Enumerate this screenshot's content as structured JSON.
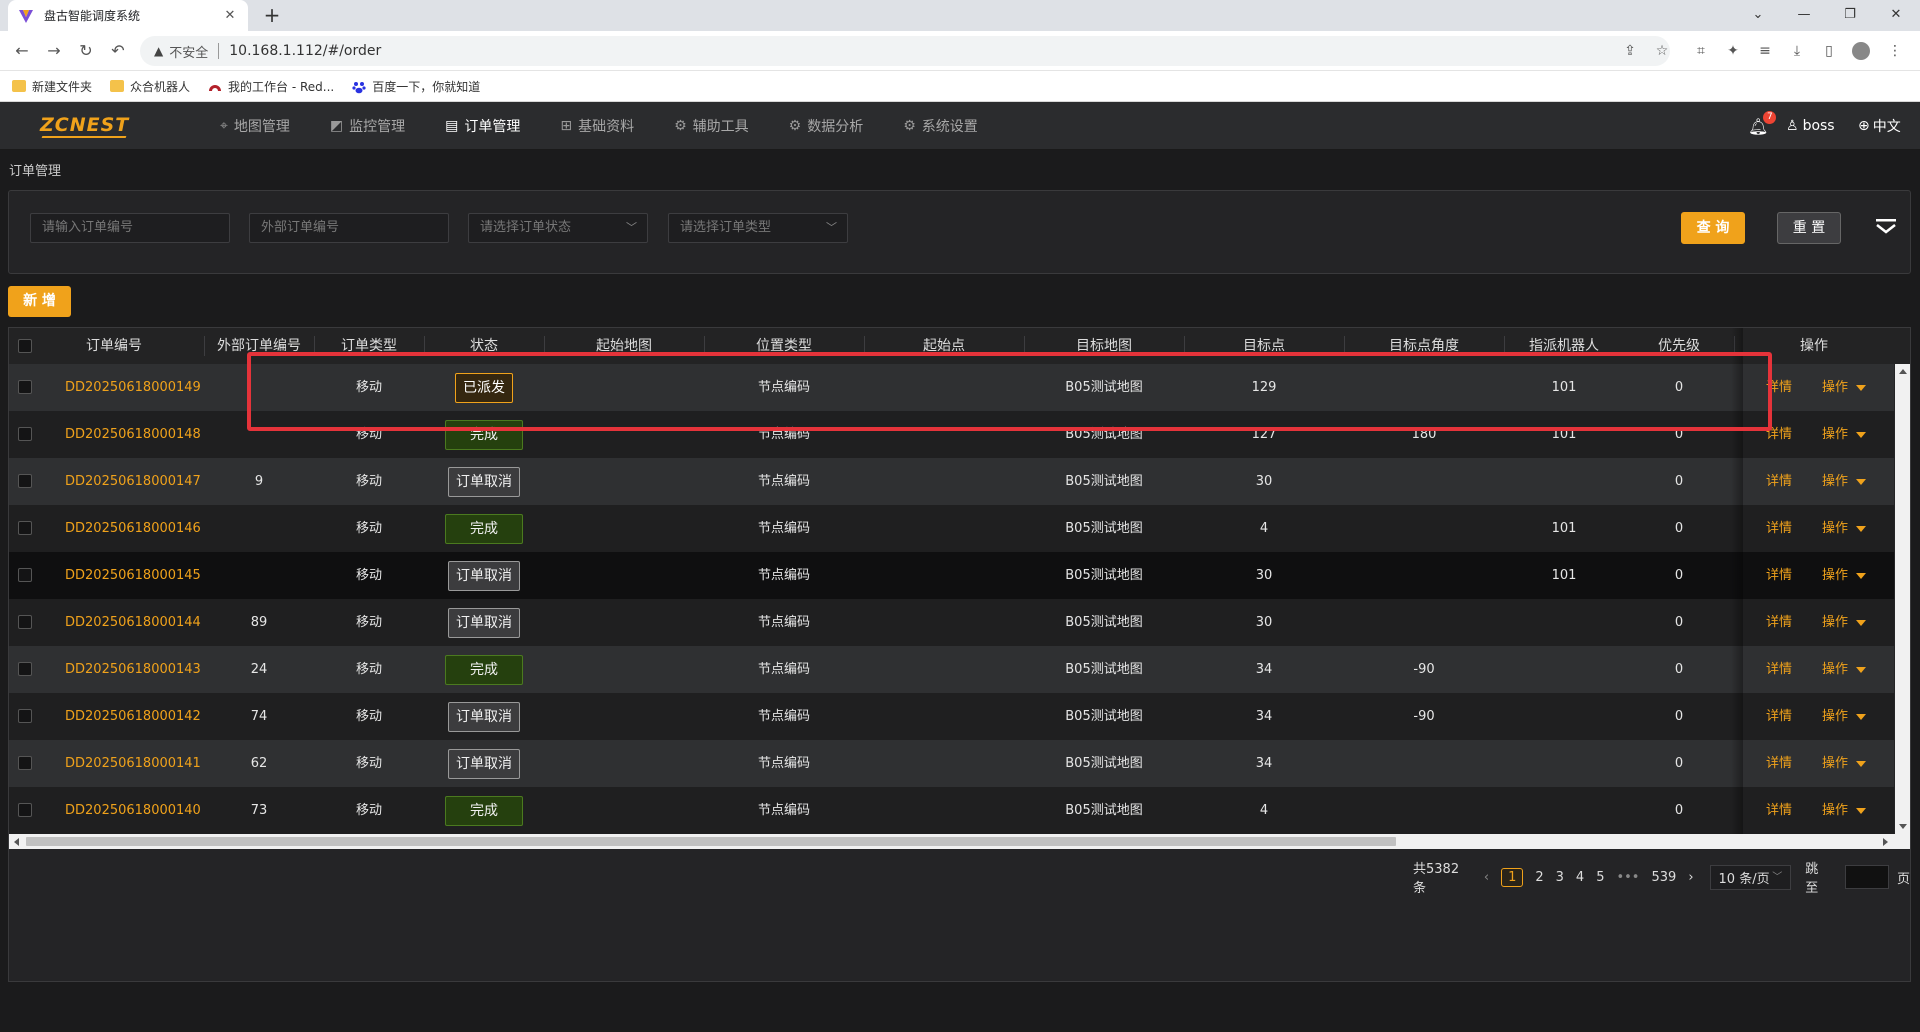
{
  "browser": {
    "tab_title": "盘古智能调度系统",
    "tab_close": "✕",
    "new_tab": "+",
    "insecure_label": "不安全",
    "url": "10.168.1.112/#/order",
    "bookmarks": [
      {
        "label": "新建文件夹",
        "icon": "folder-icon"
      },
      {
        "label": "众合机器人",
        "icon": "folder-icon"
      },
      {
        "label": "我的工作台 - Red...",
        "icon": "redmine-icon"
      },
      {
        "label": "百度一下，你就知道",
        "icon": "baidu-icon"
      }
    ]
  },
  "app": {
    "logo": "ZCNEST",
    "nav": [
      {
        "label": "地图管理",
        "icon": "map-pin-icon",
        "active": false
      },
      {
        "label": "监控管理",
        "icon": "monitor-chart-icon",
        "active": false
      },
      {
        "label": "订单管理",
        "icon": "document-icon",
        "active": true
      },
      {
        "label": "基础资料",
        "icon": "sliders-icon",
        "active": false
      },
      {
        "label": "辅助工具",
        "icon": "gear-icon",
        "active": false
      },
      {
        "label": "数据分析",
        "icon": "gear-icon",
        "active": false
      },
      {
        "label": "系统设置",
        "icon": "gear-icon",
        "active": false
      }
    ],
    "notification_count": "7",
    "user": "boss",
    "language": "中文"
  },
  "page": {
    "title": "订单管理",
    "filters": {
      "order_no_placeholder": "请输入订单编号",
      "external_no_placeholder": "外部订单编号",
      "status_placeholder": "请选择订单状态",
      "type_placeholder": "请选择订单类型"
    },
    "query_button": "查 询",
    "reset_button": "重 置",
    "add_button": "新 增"
  },
  "table": {
    "columns": [
      "订单编号",
      "外部订单编号",
      "订单类型",
      "状态",
      "起始地图",
      "位置类型",
      "起始点",
      "目标地图",
      "目标点",
      "目标点角度",
      "指派机器人",
      "优先级",
      "操作"
    ],
    "rows": [
      {
        "order_no": "DD20250618000149",
        "external_no": "",
        "type": "移动",
        "status": "已派发",
        "status_kind": "dispatched",
        "start_map": "",
        "location_type": "节点编码",
        "start_point": "",
        "target_map": "B05测试地图",
        "target_point": "129",
        "target_angle": "",
        "robot": "101",
        "priority": "0",
        "detail": "详情",
        "action": "操作"
      },
      {
        "order_no": "DD20250618000148",
        "external_no": "",
        "type": "移动",
        "status": "完成",
        "status_kind": "done",
        "start_map": "",
        "location_type": "节点编码",
        "start_point": "",
        "target_map": "B05测试地图",
        "target_point": "127",
        "target_angle": "180",
        "robot": "101",
        "priority": "0",
        "detail": "详情",
        "action": "操作"
      },
      {
        "order_no": "DD20250618000147",
        "external_no": "9",
        "type": "移动",
        "status": "订单取消",
        "status_kind": "cancel",
        "start_map": "",
        "location_type": "节点编码",
        "start_point": "",
        "target_map": "B05测试地图",
        "target_point": "30",
        "target_angle": "",
        "robot": "",
        "priority": "0",
        "detail": "详情",
        "action": "操作"
      },
      {
        "order_no": "DD20250618000146",
        "external_no": "",
        "type": "移动",
        "status": "完成",
        "status_kind": "done",
        "start_map": "",
        "location_type": "节点编码",
        "start_point": "",
        "target_map": "B05测试地图",
        "target_point": "4",
        "target_angle": "",
        "robot": "101",
        "priority": "0",
        "detail": "详情",
        "action": "操作"
      },
      {
        "order_no": "DD20250618000145",
        "external_no": "",
        "type": "移动",
        "status": "订单取消",
        "status_kind": "cancel",
        "start_map": "",
        "location_type": "节点编码",
        "start_point": "",
        "target_map": "B05测试地图",
        "target_point": "30",
        "target_angle": "",
        "robot": "101",
        "priority": "0",
        "detail": "详情",
        "action": "操作"
      },
      {
        "order_no": "DD20250618000144",
        "external_no": "89",
        "type": "移动",
        "status": "订单取消",
        "status_kind": "cancel",
        "start_map": "",
        "location_type": "节点编码",
        "start_point": "",
        "target_map": "B05测试地图",
        "target_point": "30",
        "target_angle": "",
        "robot": "",
        "priority": "0",
        "detail": "详情",
        "action": "操作"
      },
      {
        "order_no": "DD20250618000143",
        "external_no": "24",
        "type": "移动",
        "status": "完成",
        "status_kind": "done",
        "start_map": "",
        "location_type": "节点编码",
        "start_point": "",
        "target_map": "B05测试地图",
        "target_point": "34",
        "target_angle": "-90",
        "robot": "",
        "priority": "0",
        "detail": "详情",
        "action": "操作"
      },
      {
        "order_no": "DD20250618000142",
        "external_no": "74",
        "type": "移动",
        "status": "订单取消",
        "status_kind": "cancel",
        "start_map": "",
        "location_type": "节点编码",
        "start_point": "",
        "target_map": "B05测试地图",
        "target_point": "34",
        "target_angle": "-90",
        "robot": "",
        "priority": "0",
        "detail": "详情",
        "action": "操作"
      },
      {
        "order_no": "DD20250618000141",
        "external_no": "62",
        "type": "移动",
        "status": "订单取消",
        "status_kind": "cancel",
        "start_map": "",
        "location_type": "节点编码",
        "start_point": "",
        "target_map": "B05测试地图",
        "target_point": "34",
        "target_angle": "",
        "robot": "",
        "priority": "0",
        "detail": "详情",
        "action": "操作"
      },
      {
        "order_no": "DD20250618000140",
        "external_no": "73",
        "type": "移动",
        "status": "完成",
        "status_kind": "done",
        "start_map": "",
        "location_type": "节点编码",
        "start_point": "",
        "target_map": "B05测试地图",
        "target_point": "4",
        "target_angle": "",
        "robot": "",
        "priority": "0",
        "detail": "详情",
        "action": "操作"
      }
    ]
  },
  "pagination": {
    "total": "共5382条",
    "pages": [
      "1",
      "2",
      "3",
      "4",
      "5"
    ],
    "ellipsis": "•••",
    "last_page": "539",
    "page_size": "10 条/页",
    "jump_label": "跳至",
    "page_suffix": "页"
  },
  "colors": {
    "accent": "#f0a21b",
    "highlight_box": "#e5333a",
    "done_tag": "#25400e",
    "cancel_tag": "#3c3c3e"
  }
}
